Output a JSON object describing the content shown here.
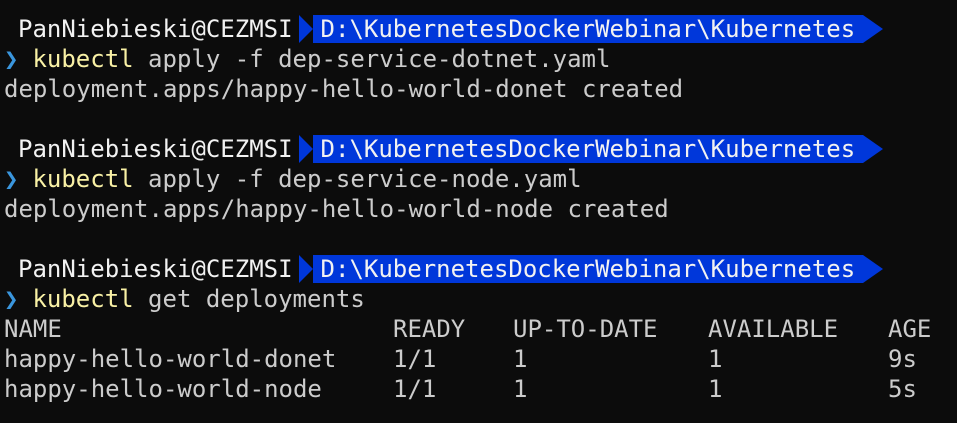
{
  "prompt": {
    "user": "PanNiebieski@CEZMSI",
    "path": "D:\\KubernetesDockerWebinar\\Kubernetes",
    "chevron": "❯"
  },
  "blocks": [
    {
      "command": {
        "name": "kubectl",
        "args": " apply -f dep-service-dotnet.yaml"
      },
      "output": "deployment.apps/happy-hello-world-donet created"
    },
    {
      "command": {
        "name": "kubectl",
        "args": " apply -f dep-service-node.yaml"
      },
      "output": "deployment.apps/happy-hello-world-node created"
    },
    {
      "command": {
        "name": "kubectl",
        "args": " get deployments"
      }
    }
  ],
  "deployments_table": {
    "headers": [
      "NAME",
      "READY",
      "UP-TO-DATE",
      "AVAILABLE",
      "AGE"
    ],
    "rows": [
      [
        "happy-hello-world-donet",
        "1/1",
        "1",
        "1",
        "9s"
      ],
      [
        "happy-hello-world-node",
        "1/1",
        "1",
        "1",
        "5s"
      ]
    ]
  },
  "colors": {
    "background": "#0c0c0c",
    "foreground": "#cccccc",
    "path_segment": "#0037da",
    "command": "#f9f1a5",
    "chevron": "#3a96dd"
  }
}
